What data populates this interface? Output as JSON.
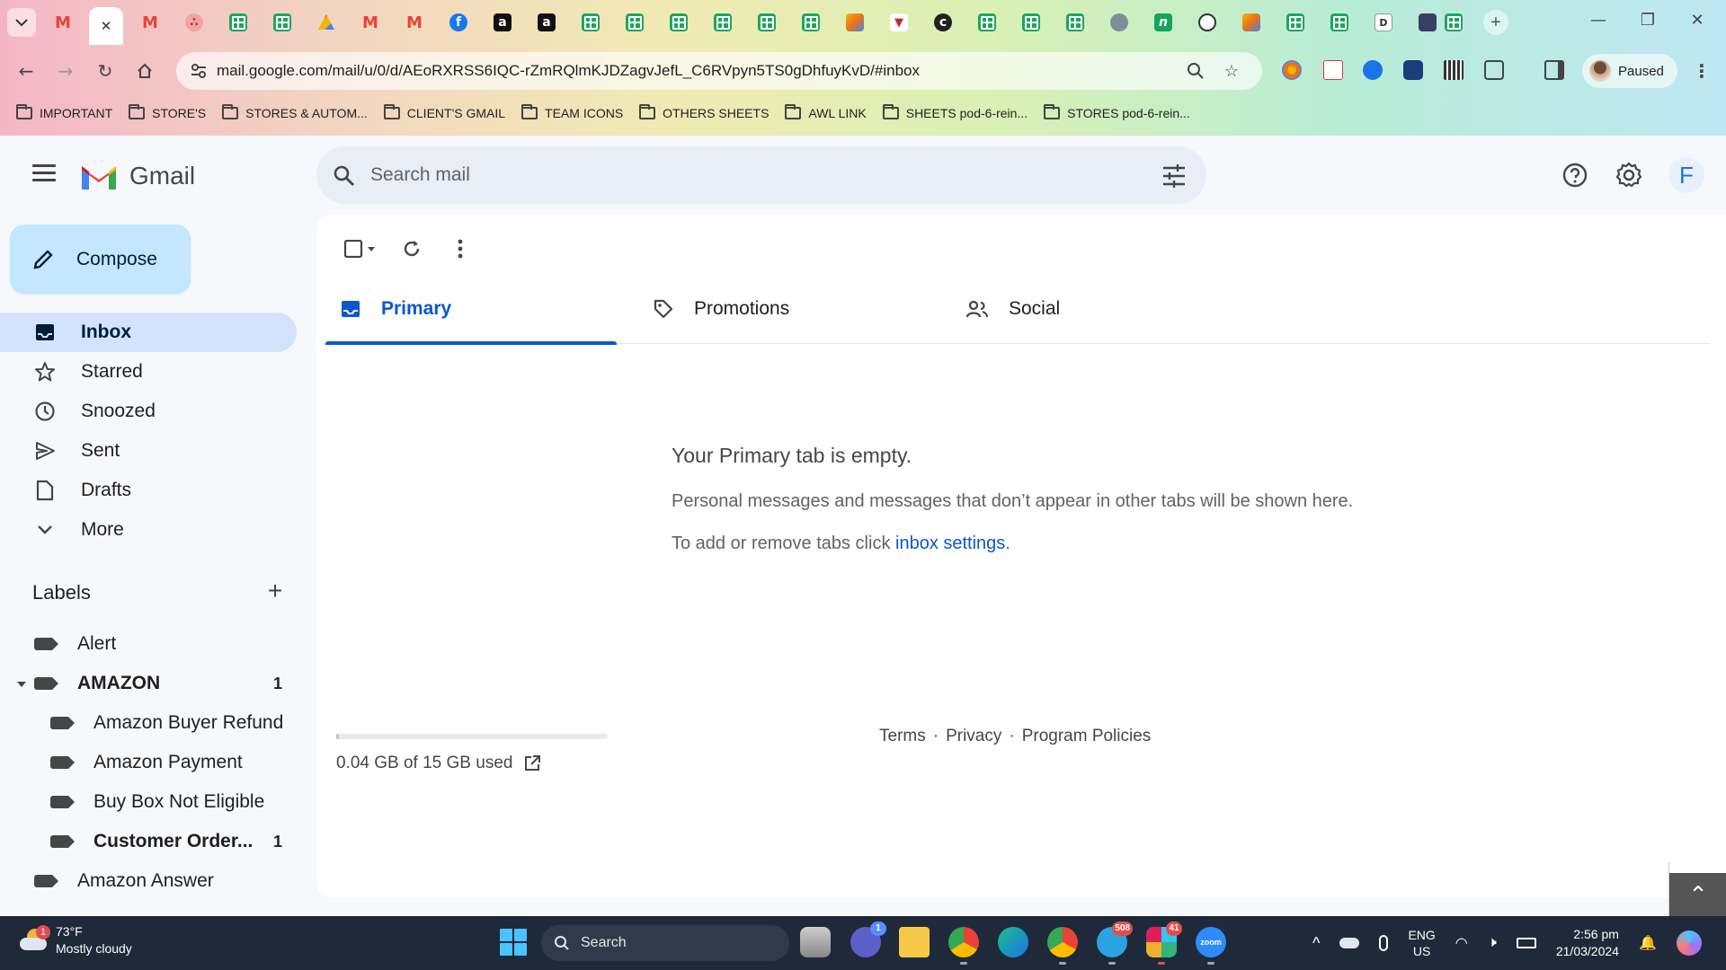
{
  "browser": {
    "url": "mail.google.com/mail/u/0/d/AEoRXRSS6IQC-rZmRQlmKJDZagvJefL_C6RVpyn5TS0gDhfuyKvD/#inbox",
    "profile_label": "Paused",
    "tab_close_glyph": "✕",
    "bookmarks": [
      {
        "label": "IMPORTANT"
      },
      {
        "label": "STORE'S"
      },
      {
        "label": "STORES & AUTOM..."
      },
      {
        "label": "CLIENT'S GMAIL"
      },
      {
        "label": "TEAM ICONS"
      },
      {
        "label": "OTHERS SHEETS"
      },
      {
        "label": "AWL LINK"
      },
      {
        "label": "SHEETS pod-6-rein..."
      },
      {
        "label": "STORES pod-6-rein..."
      }
    ]
  },
  "header": {
    "app_name": "Gmail",
    "search_placeholder": "Search mail",
    "account_initial": "F"
  },
  "sidebar": {
    "compose_label": "Compose",
    "items": [
      {
        "label": "Inbox",
        "icon": "inbox-icon",
        "active": true
      },
      {
        "label": "Starred",
        "icon": "star-icon"
      },
      {
        "label": "Snoozed",
        "icon": "clock-icon"
      },
      {
        "label": "Sent",
        "icon": "send-icon"
      },
      {
        "label": "Drafts",
        "icon": "draft-icon"
      },
      {
        "label": "More",
        "icon": "chevron-down-icon"
      }
    ],
    "labels_heading": "Labels",
    "labels": [
      {
        "label": "Alert",
        "count": ""
      },
      {
        "label": "AMAZON",
        "count": "1"
      },
      {
        "label": "Amazon Buyer Refund",
        "count": ""
      },
      {
        "label": "Amazon Payment",
        "count": ""
      },
      {
        "label": "Buy Box Not Eligible",
        "count": ""
      },
      {
        "label": "Customer Order...",
        "count": "1"
      },
      {
        "label": "Amazon Answer",
        "count": ""
      }
    ]
  },
  "main": {
    "tabs": [
      {
        "label": "Primary",
        "icon": "inbox-icon",
        "active": true
      },
      {
        "label": "Promotions",
        "icon": "tag-icon"
      },
      {
        "label": "Social",
        "icon": "people-icon"
      }
    ],
    "empty_title": "Your Primary tab is empty.",
    "empty_body": "Personal messages and messages that don’t appear in other tabs will be shown here.",
    "empty_hint_prefix": "To add or remove tabs click ",
    "empty_hint_link": "inbox settings",
    "empty_hint_suffix": ".",
    "storage_text": "0.04 GB of 15 GB used",
    "storage_fraction": 0.003,
    "footer": {
      "terms": "Terms",
      "sep1": "·",
      "privacy": "Privacy",
      "sep2": "·",
      "policies": "Program Policies"
    }
  },
  "taskbar": {
    "weather_temp": "73°F",
    "weather_desc": "Mostly cloudy",
    "weather_badge": "1",
    "search_label": "Search",
    "apps": [
      {
        "name": "task-view",
        "badge": ""
      },
      {
        "name": "teams-chat",
        "badge": "1"
      },
      {
        "name": "file-explorer",
        "badge": ""
      },
      {
        "name": "chrome",
        "badge": ""
      },
      {
        "name": "edge",
        "badge": ""
      },
      {
        "name": "chrome-2",
        "badge": ""
      },
      {
        "name": "telegram",
        "badge": "508"
      },
      {
        "name": "slack",
        "badge": "41"
      },
      {
        "name": "zoom",
        "badge": ""
      }
    ],
    "zoom_text": "zoom",
    "lang_top": "ENG",
    "lang_bottom": "US",
    "time": "2:56 pm",
    "date": "21/03/2024"
  }
}
